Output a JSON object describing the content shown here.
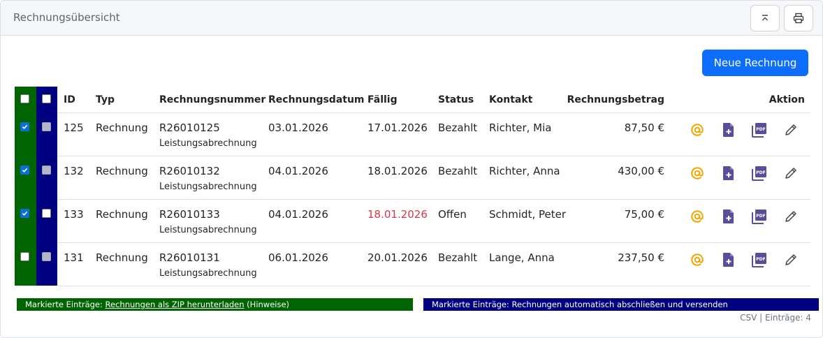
{
  "header": {
    "title": "Rechnungsübersicht"
  },
  "toolbar": {
    "new_invoice_label": "Neue Rechnung"
  },
  "table": {
    "columns": {
      "id": "ID",
      "type": "Typ",
      "number": "Rechnungsnummer",
      "date": "Rechnungsdatum",
      "due": "Fällig",
      "status": "Status",
      "contact": "Kontakt",
      "amount": "Rechnungsbetrag",
      "action": "Aktion"
    },
    "rows": [
      {
        "green_checked": true,
        "blue_checked": false,
        "blue_state": "disabled",
        "id": "125",
        "type": "Rechnung",
        "number": "R26010125",
        "sub": "Leistungsabrechnung",
        "date": "03.01.2026",
        "due": "17.01.2026",
        "due_overdue": false,
        "status": "Bezahlt",
        "contact": "Richter, Mia",
        "amount": "87,50 €"
      },
      {
        "green_checked": true,
        "blue_checked": false,
        "blue_state": "disabled",
        "id": "132",
        "type": "Rechnung",
        "number": "R26010132",
        "sub": "Leistungsabrechnung",
        "date": "04.01.2026",
        "due": "18.01.2026",
        "due_overdue": false,
        "status": "Bezahlt",
        "contact": "Richter, Anna",
        "amount": "430,00 €"
      },
      {
        "green_checked": true,
        "blue_checked": false,
        "blue_state": "enabled",
        "id": "133",
        "type": "Rechnung",
        "number": "R26010133",
        "sub": "Leistungsabrechnung",
        "date": "04.01.2026",
        "due": "18.01.2026",
        "due_overdue": true,
        "status": "Offen",
        "contact": "Schmidt, Peter",
        "amount": "75,00 €"
      },
      {
        "green_checked": false,
        "blue_checked": false,
        "blue_state": "disabled",
        "id": "131",
        "type": "Rechnung",
        "number": "R26010131",
        "sub": "Leistungsabrechnung",
        "date": "06.01.2026",
        "due": "20.01.2026",
        "due_overdue": false,
        "status": "Bezahlt",
        "contact": "Lange, Anna",
        "amount": "237,50 €"
      }
    ],
    "row_actions": [
      "email-icon",
      "add-document-icon",
      "pdf-icon",
      "edit-pencil-icon"
    ]
  },
  "bulk": {
    "green_prefix": "Markierte Einträge: ",
    "green_link": "Rechnungen als ZIP herunterladen",
    "green_suffix": " (Hinweise)",
    "blue_text": "Markierte Einträge: Rechnungen automatisch abschließen und versenden"
  },
  "footer": {
    "csv": "CSV",
    "separator": " | ",
    "entries": "Einträge: 4"
  },
  "colors": {
    "primary": "#0d6efd",
    "green_column": "#006400",
    "blue_column": "#000080",
    "overdue": "#dc3545",
    "email_icon": "#f0a500",
    "document_icon": "#5c4d9a"
  }
}
